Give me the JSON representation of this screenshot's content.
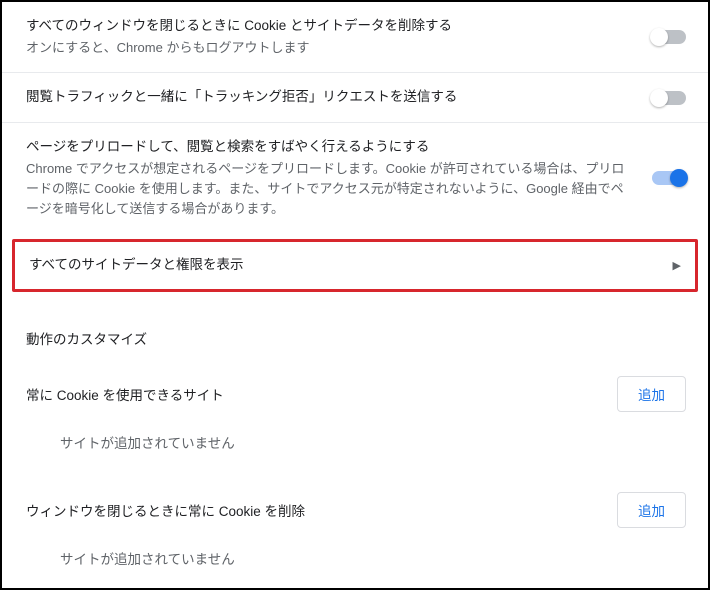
{
  "settings": [
    {
      "title": "すべてのウィンドウを閉じるときに Cookie とサイトデータを削除する",
      "subtitle": "オンにすると、Chrome からもログアウトします",
      "toggle": "off"
    },
    {
      "title": "閲覧トラフィックと一緒に「トラッキング拒否」リクエストを送信する",
      "subtitle": "",
      "toggle": "off"
    },
    {
      "title": "ページをプリロードして、閲覧と検索をすばやく行えるようにする",
      "subtitle": "Chrome でアクセスが想定されるページをプリロードします。Cookie が許可されている場合は、プリロードの際に Cookie を使用します。また、サイトでアクセス元が特定されないように、Google 経由でページを暗号化して送信する場合があります。",
      "toggle": "on"
    }
  ],
  "link_row": {
    "title": "すべてのサイトデータと権限を表示"
  },
  "custom_header": "動作のカスタマイズ",
  "subsections": [
    {
      "title": "常に Cookie を使用できるサイト",
      "add_label": "追加",
      "empty": "サイトが追加されていません"
    },
    {
      "title": "ウィンドウを閉じるときに常に Cookie を削除",
      "add_label": "追加",
      "empty": "サイトが追加されていません"
    }
  ]
}
